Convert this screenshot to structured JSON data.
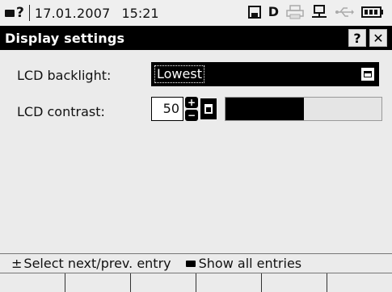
{
  "status_bar": {
    "date": "17.01.2007",
    "time": "15:21",
    "icons": [
      "keyboard-icon",
      "help-question-icon",
      "save-disk-icon",
      "drive-d-icon",
      "printer-icon",
      "network-icon",
      "usb-icon",
      "battery-icon"
    ],
    "drive_letter": "D"
  },
  "title_bar": {
    "title": "Display settings",
    "help_label": "?",
    "close_label": "✕"
  },
  "settings": {
    "backlight": {
      "label": "LCD backlight:",
      "value": "Lowest"
    },
    "contrast": {
      "label": "LCD contrast:",
      "value": "50",
      "level_fraction": 0.5,
      "increment_label": "+",
      "decrement_label": "−"
    }
  },
  "hint_bar": {
    "select_symbol": "±",
    "select_text": "Select next/prev. entry",
    "show_all_text": "Show all entries"
  },
  "softkeys": [
    "",
    "",
    "",
    "",
    "",
    ""
  ],
  "colors": {
    "title_background": "#000000",
    "window_background": "#ebebeb",
    "selection_background": "#000000"
  }
}
